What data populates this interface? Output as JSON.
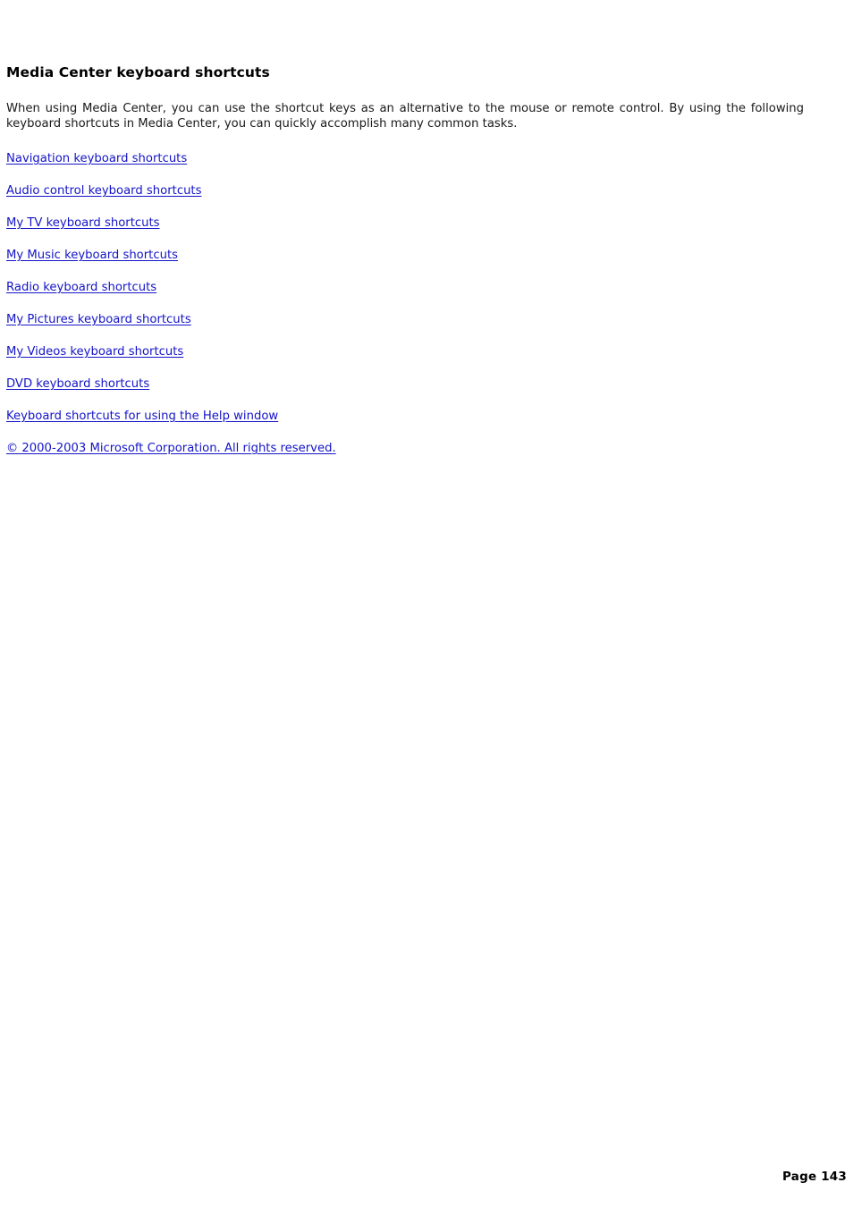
{
  "document": {
    "title": "Media Center keyboard shortcuts",
    "intro_paragraph": "When using Media Center, you can use the shortcut keys as an alternative to the mouse or remote control. By using the following keyboard shortcuts in Media Center, you can quickly accomplish many common tasks.",
    "links": [
      {
        "label": "Navigation keyboard shortcuts"
      },
      {
        "label": "Audio control keyboard shortcuts"
      },
      {
        "label": "My TV keyboard shortcuts"
      },
      {
        "label": "My Music keyboard shortcuts"
      },
      {
        "label": "Radio keyboard shortcuts"
      },
      {
        "label": "My Pictures keyboard shortcuts"
      },
      {
        "label": "My Videos keyboard shortcuts"
      },
      {
        "label": "DVD keyboard shortcuts"
      },
      {
        "label": "Keyboard shortcuts for using the Help window"
      }
    ],
    "copyright": "© 2000-2003 Microsoft Corporation. All rights reserved.",
    "page_footer": "Page 143"
  },
  "colors": {
    "link": "#1414c8",
    "text": "#1a1a1a",
    "heading": "#000000",
    "background": "#ffffff"
  }
}
